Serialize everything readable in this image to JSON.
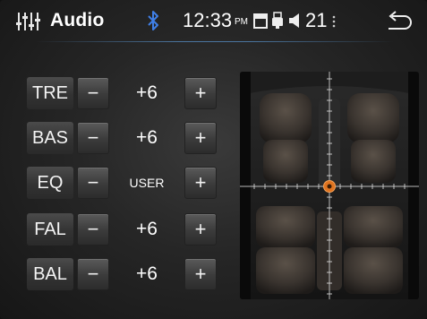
{
  "app": {
    "title": "Audio"
  },
  "status": {
    "time": "12:33",
    "ampm": "PM",
    "volume": "21"
  },
  "controls": [
    {
      "label": "TRE",
      "value": "+6"
    },
    {
      "label": "BAS",
      "value": "+6"
    },
    {
      "label": "EQ",
      "value": "USER"
    },
    {
      "label": "FAL",
      "value": "+6"
    },
    {
      "label": "BAL",
      "value": "+6"
    }
  ],
  "buttons": {
    "minus": "−",
    "plus": "+"
  },
  "icons": {
    "equalizer": "equalizer-icon",
    "bluetooth": "bluetooth-icon",
    "sdcard": "sd-card-icon",
    "usb": "usb-icon",
    "volume": "speaker-icon",
    "more": "more-icon",
    "back": "back-icon"
  },
  "colors": {
    "bluetooth": "#3f7fe6",
    "accent_line": "#5a96d2",
    "cursor": "#e07420"
  }
}
